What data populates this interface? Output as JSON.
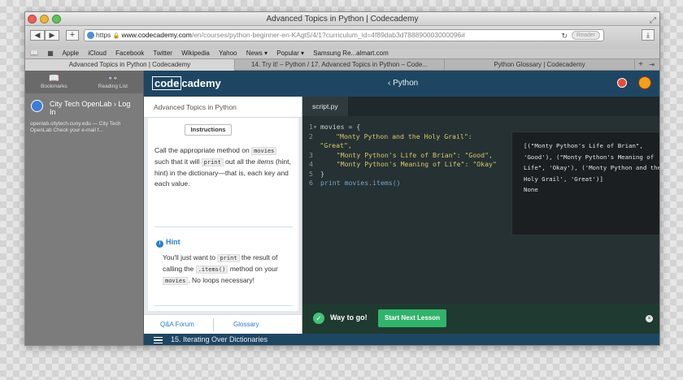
{
  "window": {
    "title": "Advanced Topics in Python | Codecademy",
    "fullscreen_glyph": "⤢"
  },
  "toolbar": {
    "back_glyph": "◀",
    "forward_glyph": "▶",
    "add_glyph": "+",
    "url_scheme": "https",
    "url_domain": "www.codecademy.com",
    "url_path": "/en/courses/python-beginner-en-KAgt5/4/1?curriculum_id=4f89dab3d788890003000096#",
    "reload_glyph": "↻",
    "reader_label": "Reader",
    "download_glyph": "⤓"
  },
  "bookmarks": [
    "Apple",
    "iCloud",
    "Facebook",
    "Twitter",
    "Wikipedia",
    "Yahoo",
    "News ▾",
    "Popular ▾",
    "Samsung Re...almart.com"
  ],
  "tabs": [
    {
      "label": "Advanced Topics in Python | Codecademy"
    },
    {
      "label": "14. Try it! – Python / 17. Advanced Topics in Python – Code..."
    },
    {
      "label": "Python Glossary | Codecademy"
    }
  ],
  "tab_plus": "+",
  "tab_overflow": "⇥",
  "reading_list": {
    "bookmarks_label": "Bookmarks",
    "bookmarks_glyph": "📖",
    "reading_list_label": "Reading List",
    "reading_list_glyph": "👓",
    "item_title": "City Tech OpenLab › Log In",
    "item_desc": "openlab.citytech.cuny.edu — City Tech OpenLab Check your e-mail f..."
  },
  "app": {
    "logo_boxed": "code",
    "logo_rest": "cademy",
    "course": "‹ Python"
  },
  "lesson": {
    "title": "Advanced Topics in Python",
    "instructions_label": "Instructions",
    "instr_1": "Call the appropriate method on",
    "instr_code_1": "movies",
    "instr_2": " such that it will ",
    "instr_code_2": "print",
    "instr_3": " out all the ",
    "instr_em": "items",
    "instr_4": " (hint, hint) in the dictionary—that is, each key and each value.",
    "hint_icon": "i",
    "hint_label": "Hint",
    "hint_1": "You'll just want to ",
    "hint_code_1": "print",
    "hint_2": " the result of calling the ",
    "hint_code_2": ".items()",
    "hint_3": " method on your ",
    "hint_code_3": "movies",
    "hint_4": ". No loops necessary!",
    "qa_label": "Q&A Forum",
    "glossary_label": "Glossary"
  },
  "editor": {
    "filename": "script.py",
    "lines": [
      {
        "num": "1",
        "marker": "▾",
        "text": "movies = {"
      },
      {
        "num": "2",
        "marker": "",
        "text": "    \"Monty Python and the Holy Grail\": \"Great\","
      },
      {
        "num": "3",
        "marker": "",
        "text": "    \"Monty Python's Life of Brian\": \"Good\","
      },
      {
        "num": "4",
        "marker": "",
        "text": "    \"Monty Python's Meaning of Life\": \"Okay\""
      },
      {
        "num": "5",
        "marker": "",
        "text": "}"
      },
      {
        "num": "6",
        "marker": "",
        "text": "print movies.items()"
      }
    ],
    "output": "[(\"Monty Python's Life of Brian\", 'Good'), (\"Monty Python's Meaning of Life\", 'Okay'), ('Monty Python and the Holy Grail', 'Great')]\nNone"
  },
  "success": {
    "check_glyph": "✓",
    "message": "Way to go!",
    "next_label": "Start Next Lesson",
    "close_glyph": "×"
  },
  "bottom": {
    "exercise_title": "15. Iterating Over Dictionaries"
  },
  "colors": {
    "header_blue": "#1e4663",
    "success_green": "#31b36b",
    "hint_blue": "#2a7fcb"
  }
}
